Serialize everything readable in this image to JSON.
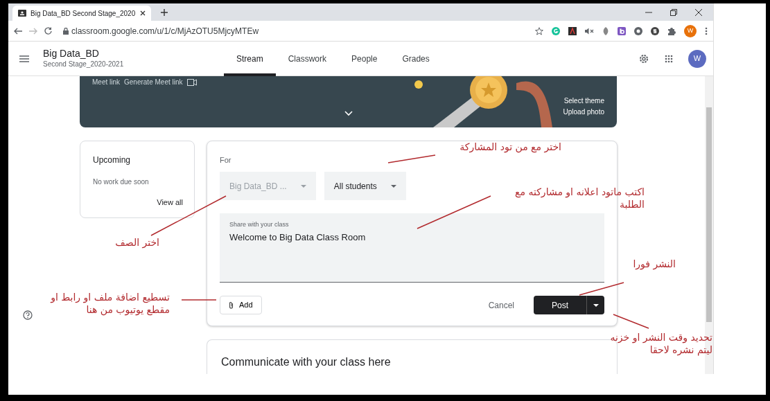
{
  "browser": {
    "tab_title": "Big Data_BD Second Stage_2020",
    "url": "classroom.google.com/u/1/c/MjAzOTU5MjcyMTEw",
    "profile_initial": "W"
  },
  "app_header": {
    "class_name": "Big Data_BD",
    "section": "Second Stage_2020-2021",
    "avatar_initial": "W",
    "tabs": [
      {
        "label": "Stream",
        "selected": true
      },
      {
        "label": "Classwork",
        "selected": false
      },
      {
        "label": "People",
        "selected": false
      },
      {
        "label": "Grades",
        "selected": false
      }
    ]
  },
  "banner": {
    "meet_link": "Meet link",
    "generate_meet_link": "Generate Meet link",
    "select_theme": "Select theme",
    "upload_photo": "Upload photo"
  },
  "upcoming": {
    "title": "Upcoming",
    "message": "No work due soon",
    "view_all": "View all"
  },
  "post_form": {
    "for_label": "For",
    "selects": [
      {
        "value": "Big Data_BD ...",
        "disabled": true
      },
      {
        "value": "All students",
        "disabled": false
      }
    ],
    "message_label": "Share with your class",
    "message": "Welcome to Big Data Class Room",
    "add": "Add",
    "cancel": "Cancel",
    "post": "Post"
  },
  "communicate": "Communicate with your class here",
  "annotations": [
    {
      "text": "اختر مع من تود المشاركة"
    },
    {
      "text": "اكتب ماتود اعلانه او مشاركته مع الطلبة"
    },
    {
      "text": "اختر الصف"
    },
    {
      "text": "تسطيع اضافة ملف او رابط او مقطع يوتيوب من هنا"
    },
    {
      "text": "النشر فورا"
    },
    {
      "text": "تحديد وقت النشر او خزنه ليتم نشره لاحقا"
    }
  ]
}
